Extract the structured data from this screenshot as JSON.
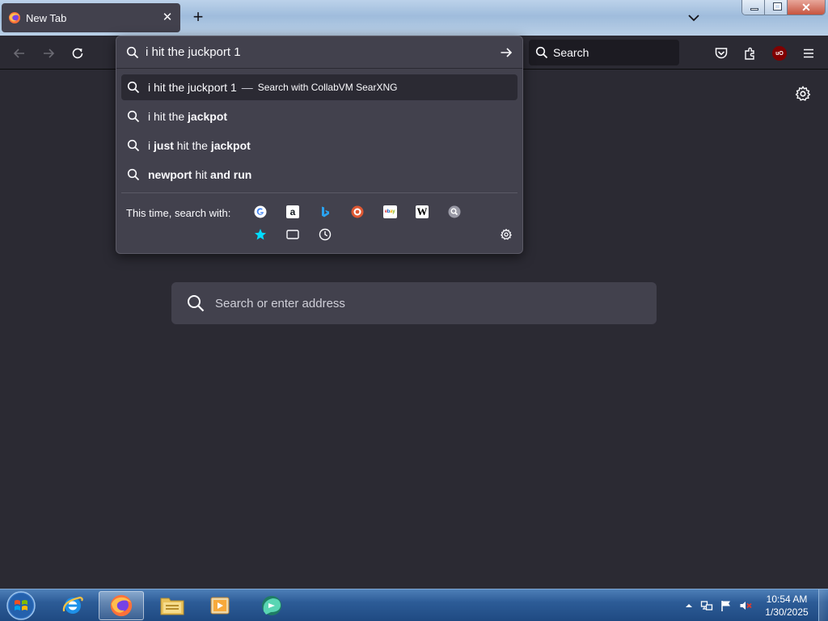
{
  "browser": {
    "tab": {
      "title": "New Tab",
      "favicon": "firefox-icon",
      "close_icon": "close-icon"
    },
    "new_tab_icon": "plus-icon",
    "tab_list_icon": "chevron-down-icon",
    "window_controls": [
      "minimize-icon",
      "restore-icon",
      "close-icon"
    ]
  },
  "navbar": {
    "back_icon": "back-arrow-icon",
    "forward_icon": "forward-arrow-icon",
    "reload_icon": "reload-icon",
    "search": {
      "placeholder": "Search"
    },
    "pocket_icon": "pocket-icon",
    "extensions_icon": "extensions-icon",
    "ublock_label": "uO",
    "menu_icon": "hamburger-menu-icon"
  },
  "urlbar": {
    "value": "i hit the juckport 1",
    "go_icon": "arrow-right-icon",
    "suggestions": [
      {
        "pre": "i hit the juckport 1",
        "dash": "—",
        "action": "Search with CollabVM SearXNG",
        "selected": true
      },
      {
        "parts": [
          {
            "t": "i hit the ",
            "b": false
          },
          {
            "t": "jackpot",
            "b": true
          }
        ]
      },
      {
        "parts": [
          {
            "t": "i ",
            "b": false
          },
          {
            "t": "just",
            "b": true
          },
          {
            "t": " hit the ",
            "b": false
          },
          {
            "t": "jackpot",
            "b": true
          }
        ]
      },
      {
        "parts": [
          {
            "t": "newport",
            "b": true
          },
          {
            "t": " hit ",
            "b": false
          },
          {
            "t": "and run",
            "b": true
          }
        ]
      }
    ],
    "this_time_label": "This time, search with:",
    "engines": [
      {
        "name": "google-icon",
        "glyph": "G",
        "bg": "#ffffff",
        "fg": "#4285f4"
      },
      {
        "name": "amazon-icon",
        "glyph": "a",
        "bg": "#ffffff",
        "fg": "#131921"
      },
      {
        "name": "bing-icon",
        "glyph": "b",
        "bg": "transparent",
        "fg": "#2aa3f0"
      },
      {
        "name": "duckduckgo-icon",
        "glyph": "D",
        "bg": "#de5833",
        "fg": "#ffffff"
      },
      {
        "name": "ebay-icon",
        "glyph": "ebay",
        "bg": "#ffffff",
        "fg": "#e53238"
      },
      {
        "name": "wikipedia-icon",
        "glyph": "W",
        "bg": "#ffffff",
        "fg": "#000000"
      },
      {
        "name": "searxng-icon",
        "glyph": "○",
        "bg": "#9a9aa6",
        "fg": "#ffffff"
      }
    ],
    "modes": [
      "bookmarks-star-icon",
      "tabs-icon",
      "history-clock-icon"
    ],
    "settings_icon": "gear-icon"
  },
  "newtab": {
    "settings_icon": "gear-icon",
    "search": {
      "placeholder": "Search or enter address"
    }
  },
  "taskbar": {
    "start_icon": "windows-start-icon",
    "items": [
      {
        "name": "internet-explorer-icon",
        "active": false
      },
      {
        "name": "firefox-icon",
        "active": true
      },
      {
        "name": "file-explorer-icon",
        "active": false
      },
      {
        "name": "media-player-icon",
        "active": false
      },
      {
        "name": "chat-app-icon",
        "active": false
      }
    ],
    "tray_icons": [
      "show-hidden-icons-icon",
      "network-icon",
      "action-center-flag-icon",
      "volume-muted-icon"
    ],
    "clock": {
      "time": "10:54 AM",
      "date": "1/30/2025"
    }
  }
}
